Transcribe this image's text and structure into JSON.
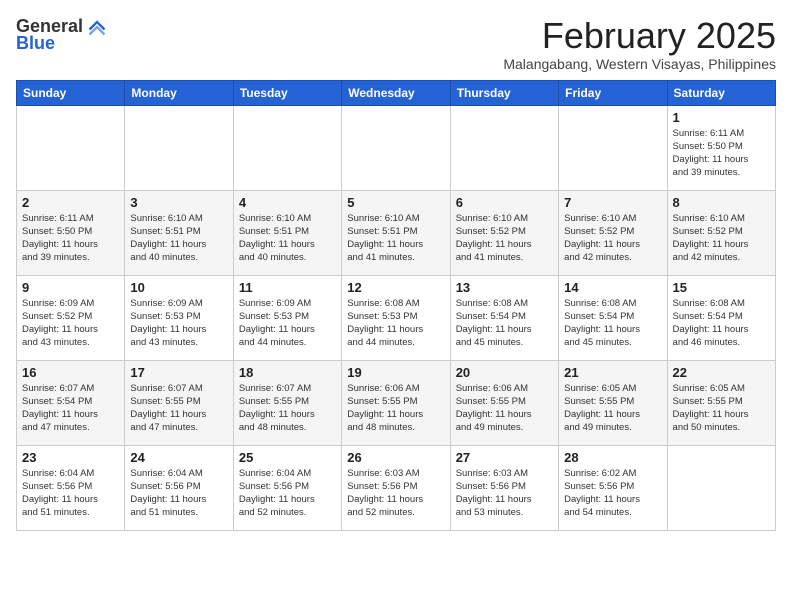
{
  "logo": {
    "general": "General",
    "blue": "Blue"
  },
  "title": {
    "month": "February 2025",
    "location": "Malangabang, Western Visayas, Philippines"
  },
  "weekdays": [
    "Sunday",
    "Monday",
    "Tuesday",
    "Wednesday",
    "Thursday",
    "Friday",
    "Saturday"
  ],
  "weeks": [
    [
      {
        "day": "",
        "info": ""
      },
      {
        "day": "",
        "info": ""
      },
      {
        "day": "",
        "info": ""
      },
      {
        "day": "",
        "info": ""
      },
      {
        "day": "",
        "info": ""
      },
      {
        "day": "",
        "info": ""
      },
      {
        "day": "1",
        "info": "Sunrise: 6:11 AM\nSunset: 5:50 PM\nDaylight: 11 hours\nand 39 minutes."
      }
    ],
    [
      {
        "day": "2",
        "info": "Sunrise: 6:11 AM\nSunset: 5:50 PM\nDaylight: 11 hours\nand 39 minutes."
      },
      {
        "day": "3",
        "info": "Sunrise: 6:10 AM\nSunset: 5:51 PM\nDaylight: 11 hours\nand 40 minutes."
      },
      {
        "day": "4",
        "info": "Sunrise: 6:10 AM\nSunset: 5:51 PM\nDaylight: 11 hours\nand 40 minutes."
      },
      {
        "day": "5",
        "info": "Sunrise: 6:10 AM\nSunset: 5:51 PM\nDaylight: 11 hours\nand 41 minutes."
      },
      {
        "day": "6",
        "info": "Sunrise: 6:10 AM\nSunset: 5:52 PM\nDaylight: 11 hours\nand 41 minutes."
      },
      {
        "day": "7",
        "info": "Sunrise: 6:10 AM\nSunset: 5:52 PM\nDaylight: 11 hours\nand 42 minutes."
      },
      {
        "day": "8",
        "info": "Sunrise: 6:10 AM\nSunset: 5:52 PM\nDaylight: 11 hours\nand 42 minutes."
      }
    ],
    [
      {
        "day": "9",
        "info": "Sunrise: 6:09 AM\nSunset: 5:52 PM\nDaylight: 11 hours\nand 43 minutes."
      },
      {
        "day": "10",
        "info": "Sunrise: 6:09 AM\nSunset: 5:53 PM\nDaylight: 11 hours\nand 43 minutes."
      },
      {
        "day": "11",
        "info": "Sunrise: 6:09 AM\nSunset: 5:53 PM\nDaylight: 11 hours\nand 44 minutes."
      },
      {
        "day": "12",
        "info": "Sunrise: 6:08 AM\nSunset: 5:53 PM\nDaylight: 11 hours\nand 44 minutes."
      },
      {
        "day": "13",
        "info": "Sunrise: 6:08 AM\nSunset: 5:54 PM\nDaylight: 11 hours\nand 45 minutes."
      },
      {
        "day": "14",
        "info": "Sunrise: 6:08 AM\nSunset: 5:54 PM\nDaylight: 11 hours\nand 45 minutes."
      },
      {
        "day": "15",
        "info": "Sunrise: 6:08 AM\nSunset: 5:54 PM\nDaylight: 11 hours\nand 46 minutes."
      }
    ],
    [
      {
        "day": "16",
        "info": "Sunrise: 6:07 AM\nSunset: 5:54 PM\nDaylight: 11 hours\nand 47 minutes."
      },
      {
        "day": "17",
        "info": "Sunrise: 6:07 AM\nSunset: 5:55 PM\nDaylight: 11 hours\nand 47 minutes."
      },
      {
        "day": "18",
        "info": "Sunrise: 6:07 AM\nSunset: 5:55 PM\nDaylight: 11 hours\nand 48 minutes."
      },
      {
        "day": "19",
        "info": "Sunrise: 6:06 AM\nSunset: 5:55 PM\nDaylight: 11 hours\nand 48 minutes."
      },
      {
        "day": "20",
        "info": "Sunrise: 6:06 AM\nSunset: 5:55 PM\nDaylight: 11 hours\nand 49 minutes."
      },
      {
        "day": "21",
        "info": "Sunrise: 6:05 AM\nSunset: 5:55 PM\nDaylight: 11 hours\nand 49 minutes."
      },
      {
        "day": "22",
        "info": "Sunrise: 6:05 AM\nSunset: 5:55 PM\nDaylight: 11 hours\nand 50 minutes."
      }
    ],
    [
      {
        "day": "23",
        "info": "Sunrise: 6:04 AM\nSunset: 5:56 PM\nDaylight: 11 hours\nand 51 minutes."
      },
      {
        "day": "24",
        "info": "Sunrise: 6:04 AM\nSunset: 5:56 PM\nDaylight: 11 hours\nand 51 minutes."
      },
      {
        "day": "25",
        "info": "Sunrise: 6:04 AM\nSunset: 5:56 PM\nDaylight: 11 hours\nand 52 minutes."
      },
      {
        "day": "26",
        "info": "Sunrise: 6:03 AM\nSunset: 5:56 PM\nDaylight: 11 hours\nand 52 minutes."
      },
      {
        "day": "27",
        "info": "Sunrise: 6:03 AM\nSunset: 5:56 PM\nDaylight: 11 hours\nand 53 minutes."
      },
      {
        "day": "28",
        "info": "Sunrise: 6:02 AM\nSunset: 5:56 PM\nDaylight: 11 hours\nand 54 minutes."
      },
      {
        "day": "",
        "info": ""
      }
    ]
  ]
}
